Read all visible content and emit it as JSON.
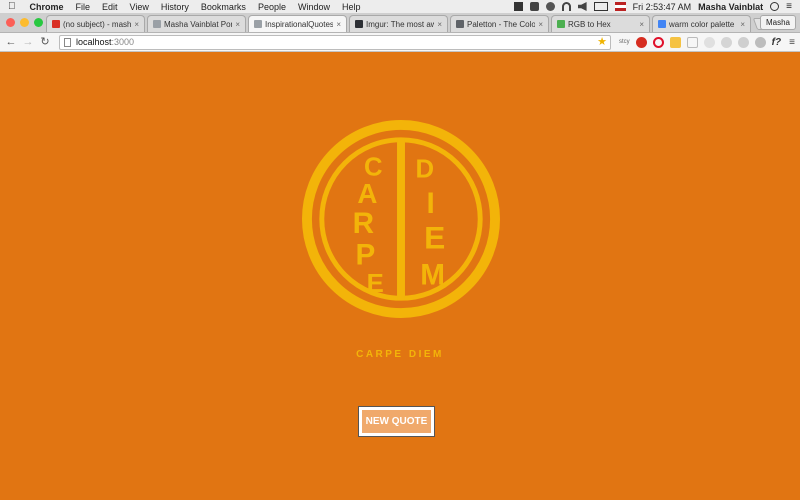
{
  "menubar": {
    "app_name": "Chrome",
    "items": [
      "File",
      "Edit",
      "View",
      "History",
      "Bookmarks",
      "People",
      "Window",
      "Help"
    ],
    "clock": "Fri 2:53:47 AM",
    "user": "Masha Vainblat"
  },
  "tabs": [
    {
      "title": "(no subject) - mashava",
      "favicon_color": "#d93025",
      "active": false
    },
    {
      "title": "Masha Vainblat Portfolio",
      "favicon_color": "#9aa0a6",
      "active": false
    },
    {
      "title": "InspirationalQuotes",
      "favicon_color": "#9aa0a6",
      "active": true
    },
    {
      "title": "Imgur: The most aweso",
      "favicon_color": "#2c2f34",
      "active": false
    },
    {
      "title": "Paletton - The Color Sc",
      "favicon_color": "#5f6368",
      "active": false
    },
    {
      "title": "RGB to Hex",
      "favicon_color": "#4caf50",
      "active": false
    },
    {
      "title": "warm color palette - Go",
      "favicon_color": "#4285f4",
      "active": false
    }
  ],
  "profile_button": "Masha",
  "toolbar": {
    "url_host": "localhost",
    "url_port": ":3000",
    "back_icon": "←",
    "forward_icon": "→",
    "reload_icon": "↻",
    "star_icon": "★",
    "ext_label": "stcy",
    "fx_label": "f?",
    "menu_icon": "≡"
  },
  "page": {
    "emblem_letters_left": "CARPE",
    "emblem_letters_right": "DIEM",
    "quote": "CARPE DIEM",
    "button_label": "NEW QUOTE"
  },
  "colors": {
    "background": "#e17512",
    "accent_gold": "#f3b409",
    "button_fill": "#f0a96b"
  }
}
